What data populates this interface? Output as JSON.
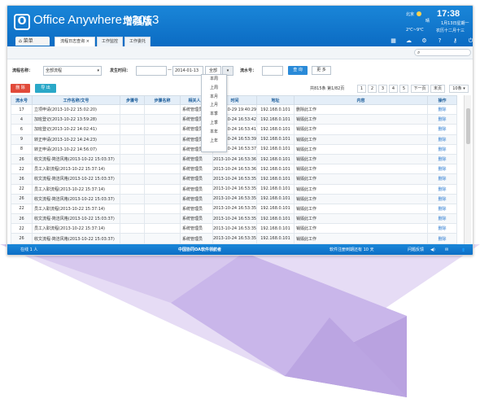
{
  "app": {
    "logo_letter": "O",
    "title": "Office Anywhere",
    "year": "2013",
    "edition": "增强版"
  },
  "weather": {
    "city": "北京",
    "condition": "晴",
    "temp": "2℃~9℃"
  },
  "clock": {
    "time": "17:38",
    "date": "1月13日星期一",
    "lunar": "农历十二月十三"
  },
  "menu_label": "菜单",
  "tabs": [
    {
      "label": "流程日志查询 ×",
      "active": true
    },
    {
      "label": "工作监控",
      "active": false
    },
    {
      "label": "工作委托",
      "active": false
    }
  ],
  "filter": {
    "flow_name_label": "流程名称：",
    "flow_name_value": "全部流程",
    "time_label": "发生时间：",
    "date_from": "",
    "date_sep": "—",
    "date_to": "2014-01-13",
    "range_value": "全部",
    "flowno_label": "流水号：",
    "flowno_value": "",
    "query_label": "查 询",
    "more_label": "更 多"
  },
  "range_options": [
    "本周",
    "上周",
    "本月",
    "上月",
    "本季",
    "上季",
    "本年",
    "上年"
  ],
  "actions": {
    "delete_label": "删 除",
    "export_label": "导 出"
  },
  "pager": {
    "summary": "共815条 第1/82页",
    "pages": [
      "1",
      "2",
      "3",
      "4",
      "5"
    ],
    "next_label": "下一页",
    "last_label": "末页",
    "page_size": "10条"
  },
  "table": {
    "headers": [
      "流水号",
      "工作名称/文号",
      "步骤号",
      "步骤名称",
      "相关人员",
      "时间",
      "地址",
      "内容",
      "操作"
    ],
    "rows": [
      [
        "17",
        "立项申请(2013-10-22 15:02:20)",
        "",
        "",
        "系统管理员",
        "2013-10-29 19:40:29",
        "192.168.0.101",
        "删除此工作",
        "删除"
      ],
      [
        "4",
        "加班登记(2013-10-22 13:59:28)",
        "",
        "",
        "系统管理员",
        "2013-10-24 16:53:42",
        "192.168.0.101",
        "销毁此工作",
        "删除"
      ],
      [
        "6",
        "加班登记(2013-10-22 14:02:41)",
        "",
        "",
        "系统管理员",
        "2013-10-24 16:53:41",
        "192.168.0.101",
        "销毁此工作",
        "删除"
      ],
      [
        "9",
        "转正申请(2013-10-22 14:24:23)",
        "",
        "",
        "系统管理员",
        "2013-10-24 16:53:39",
        "192.168.0.101",
        "销毁此工作",
        "删除"
      ],
      [
        "8",
        "转正申请(2013-10-22 14:56:07)",
        "",
        "",
        "系统管理员",
        "2013-10-24 16:53:37",
        "192.168.0.101",
        "销毁此工作",
        "删除"
      ],
      [
        "26",
        "收文流程-简洁风格(2013-10-22 15:03:37)",
        "",
        "",
        "系统管理员",
        "2013-10-24 16:53:36",
        "192.168.0.101",
        "销毁此工作",
        "删除"
      ],
      [
        "22",
        "员工入职流程(2013-10-22 15:37:14)",
        "",
        "",
        "系统管理员",
        "2013-10-24 16:53:36",
        "192.168.0.101",
        "销毁此工作",
        "删除"
      ],
      [
        "26",
        "收文流程-简洁风格(2013-10-22 15:03:37)",
        "",
        "",
        "系统管理员",
        "2013-10-24 16:53:35",
        "192.168.0.101",
        "销毁此工作",
        "删除"
      ],
      [
        "22",
        "员工入职流程(2013-10-22 15:37:14)",
        "",
        "",
        "系统管理员",
        "2013-10-24 16:53:35",
        "192.168.0.101",
        "销毁此工作",
        "删除"
      ],
      [
        "26",
        "收文流程-简洁风格(2013-10-22 15:03:37)",
        "",
        "",
        "系统管理员",
        "2013-10-24 16:53:35",
        "192.168.0.101",
        "销毁此工作",
        "删除"
      ],
      [
        "22",
        "员工入职流程(2013-10-22 15:37:14)",
        "",
        "",
        "系统管理员",
        "2013-10-24 16:53:35",
        "192.168.0.101",
        "销毁此工作",
        "删除"
      ],
      [
        "26",
        "收文流程-简洁风格(2013-10-22 15:03:37)",
        "",
        "",
        "系统管理员",
        "2013-10-24 16:53:35",
        "192.168.0.101",
        "销毁此工作",
        "删除"
      ],
      [
        "22",
        "员工入职流程(2013-10-22 15:37:14)",
        "",
        "",
        "系统管理员",
        "2013-10-24 16:53:35",
        "192.168.0.101",
        "销毁此工作",
        "删除"
      ],
      [
        "26",
        "收文流程-简洁风格(2013-10-22 15:03:37)",
        "",
        "",
        "系统管理员",
        "2013-10-24 16:53:35",
        "192.168.0.101",
        "销毁此工作",
        "删除"
      ]
    ]
  },
  "footer": {
    "online_label": "在线",
    "online_count": "1",
    "online_unit": "人",
    "company": "中国协同OA软件领航者",
    "license": "软件注册到期还有",
    "license_days": "10",
    "license_unit": "天",
    "feedback": "问题反馈"
  },
  "colors": {
    "header_blue": "#0b6bc3",
    "ribbon_light": "#d7c8ee",
    "ribbon_mid": "#b9a2e0",
    "delete_red": "#e14a3a",
    "export_cyan": "#2aa8c8"
  }
}
